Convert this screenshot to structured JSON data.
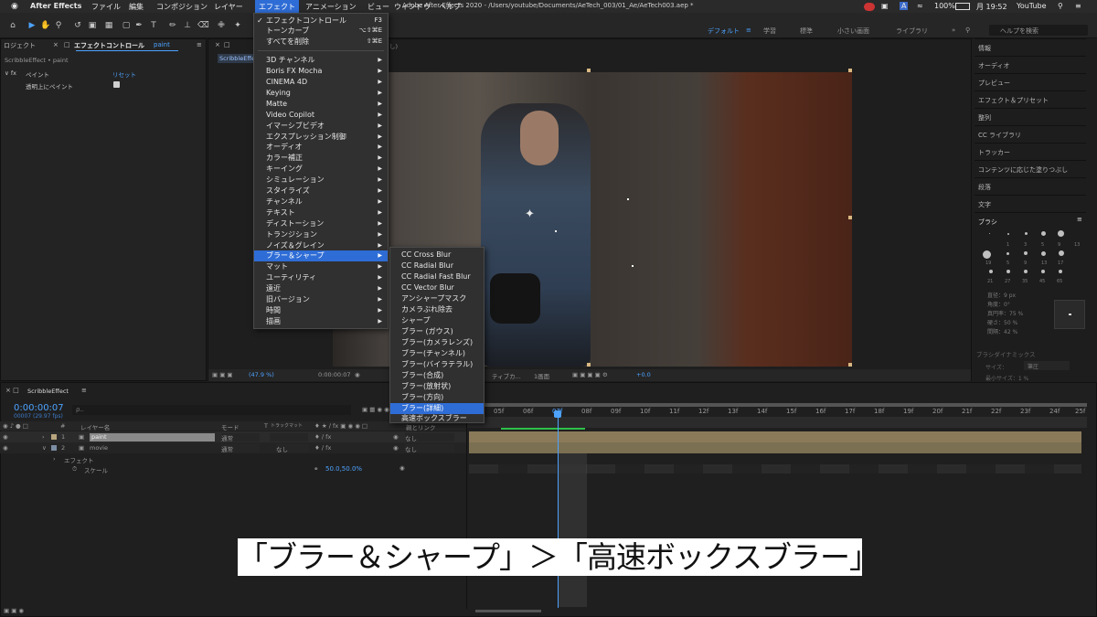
{
  "menubar": {
    "apple": "",
    "app": "After Effects",
    "items": [
      "ファイル",
      "編集",
      "コンポジション",
      "レイヤー",
      "エフェクト",
      "アニメーション",
      "ビュー",
      "ウィンドウ",
      "ヘルプ"
    ],
    "window_title": "Adobe After Effects 2020 - /Users/youtube/Documents/AeTech_003/01_Ae/AeTech003.aep *",
    "battery": "100%",
    "clock": "月 19:52",
    "user": "YouTube",
    "input_method": "A"
  },
  "workspaces": [
    "デフォルト",
    "学習",
    "標準",
    "小さい画面",
    "ライブラリ"
  ],
  "search_help": "ヘルプを検索",
  "effect_controls": {
    "tab_project": "ロジェクト",
    "tab_label": "エフェクトコントロール",
    "tab_target": "paint",
    "breadcrumb": "ScribbleEffect • paint",
    "fx_name": "ペイント",
    "reset": "リセット",
    "param": "透明上にペイント"
  },
  "comp": {
    "tab": "ScribbleEffect",
    "zoom": "(47.9 %)",
    "timecode": "0:00:00:07",
    "view": "1画面",
    "resolution": "ティブカ...",
    "offset": "+0.0"
  },
  "effect_menu": {
    "items": [
      {
        "label": "エフェクトコントロール",
        "shortcut": "F3",
        "check": "✓"
      },
      {
        "label": "トーンカーブ",
        "shortcut": "⌥⇧⌘E"
      },
      {
        "label": "すべてを削除",
        "shortcut": "⇧⌘E"
      },
      {
        "label": "3D チャンネル"
      },
      {
        "label": "Boris FX Mocha"
      },
      {
        "label": "CINEMA 4D"
      },
      {
        "label": "Keying"
      },
      {
        "label": "Matte"
      },
      {
        "label": "Video Copilot"
      },
      {
        "label": "イマーシブビデオ"
      },
      {
        "label": "エクスプレッション制御"
      },
      {
        "label": "オーディオ"
      },
      {
        "label": "カラー補正"
      },
      {
        "label": "キーイング"
      },
      {
        "label": "シミュレーション"
      },
      {
        "label": "スタイライズ"
      },
      {
        "label": "チャンネル"
      },
      {
        "label": "テキスト"
      },
      {
        "label": "ディストーション"
      },
      {
        "label": "トランジション"
      },
      {
        "label": "ノイズ＆グレイン"
      },
      {
        "label": "ブラー＆シャープ"
      },
      {
        "label": "マット"
      },
      {
        "label": "ユーティリティ"
      },
      {
        "label": "遠近"
      },
      {
        "label": "旧バージョン"
      },
      {
        "label": "時間"
      },
      {
        "label": "描画"
      }
    ]
  },
  "blur_submenu": {
    "items": [
      "CC Cross Blur",
      "CC Radial Blur",
      "CC Radial Fast Blur",
      "CC Vector Blur",
      "アンシャープマスク",
      "カメラぶれ除去",
      "シャープ",
      "ブラー (ガウス)",
      "ブラー(カメラレンズ)",
      "ブラー(チャンネル)",
      "ブラー(バイラテラル)",
      "ブラー(合成)",
      "ブラー(放射状)",
      "ブラー(方向)",
      "ブラー(詳細)",
      "高速ボックスブラー"
    ],
    "selected_index": 14
  },
  "right_panels": {
    "items": [
      "情報",
      "オーディオ",
      "プレビュー",
      "エフェクト＆プリセット",
      "整列",
      "CC ライブラリ",
      "トラッカー",
      "コンテンツに応じた塗りつぶし",
      "段落",
      "文字"
    ],
    "brush_title": "ブラシ",
    "brush_params": [
      "直径：9 px",
      "角度：0°",
      "真円率：75 %",
      "硬さ：50 %",
      "間隔：42 %"
    ],
    "brush_dynamics": "ブラシダイナミックス",
    "brush_size": "サイズ：",
    "brush_size_value": "筆圧",
    "brush_min": "最小サイズ：1 %",
    "brush_sizes": [
      "1",
      "3",
      "5",
      "9",
      "13",
      "19",
      "5",
      "9",
      "13",
      "17",
      "21",
      "27",
      "35",
      "45",
      "65"
    ]
  },
  "timeline": {
    "tab": "ScribbleEffect",
    "timecode": "0:00:00:07",
    "fps": "00007 (29.97 fps)",
    "search_placeholder": "ρ..",
    "col_layer": "レイヤー名",
    "col_mode": "モード",
    "col_t": "T",
    "col_trkmat": "トラックマット",
    "col_parent": "親とリンク",
    "rows": [
      {
        "num": "1",
        "name": "paint",
        "mode": "通常",
        "parent": "なし"
      },
      {
        "num": "2",
        "name": "movie",
        "mode": "通常",
        "trk": "なし",
        "parent": "なし"
      }
    ],
    "effect_label": "エフェクト",
    "scale_label": "スケール",
    "scale_value": "50.0,50.0%",
    "ticks": [
      "05f",
      "06f",
      "07f",
      "08f",
      "09f",
      "10f",
      "11f",
      "12f",
      "13f",
      "14f",
      "15f",
      "16f",
      "17f",
      "18f",
      "19f",
      "20f",
      "21f",
      "22f",
      "23f",
      "24f",
      "25f"
    ]
  },
  "caption": "「ブラー＆シャープ」＞「高速ボックスブラー」",
  "colors": {
    "accent": "#2f6dd6",
    "timecode": "#4da3ff",
    "layer1": "#8b7a5a",
    "layer2": "#7b7052"
  }
}
